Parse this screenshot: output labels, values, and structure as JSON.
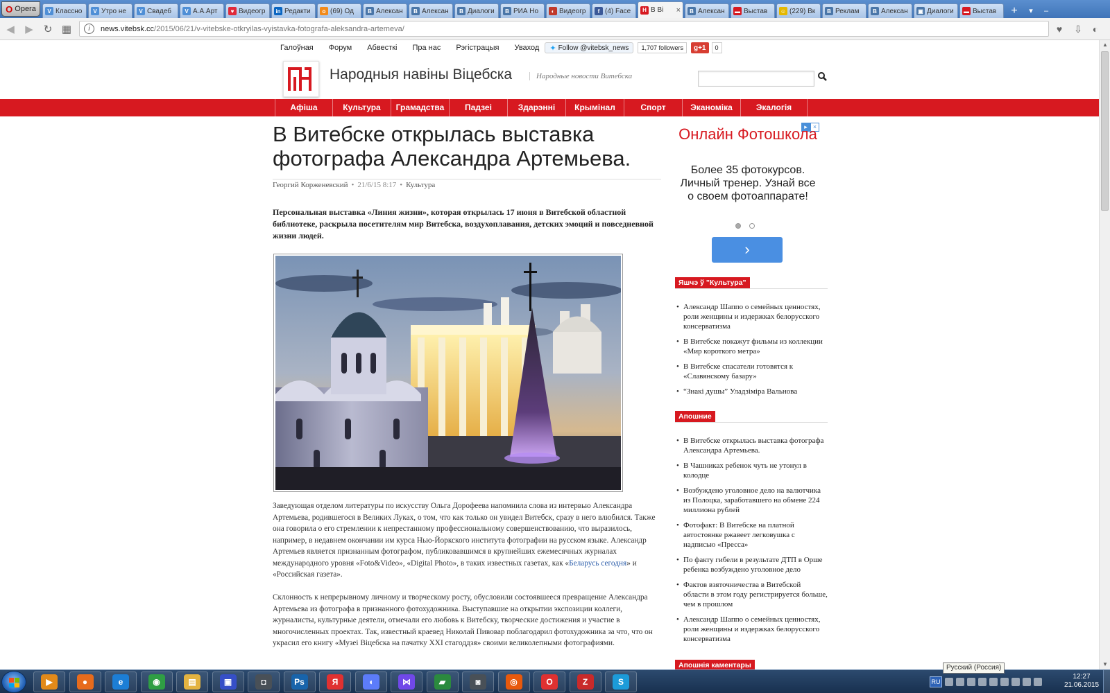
{
  "browser": {
    "menu_label": "Opera",
    "tabs": [
      {
        "label": "Классно",
        "fav": "V",
        "color": "#4f8fd6"
      },
      {
        "label": "Утро не",
        "fav": "V",
        "color": "#4f8fd6"
      },
      {
        "label": "Свадеб",
        "fav": "V",
        "color": "#4f8fd6"
      },
      {
        "label": "А.А.Арт",
        "fav": "V",
        "color": "#4f8fd6"
      },
      {
        "label": "Видеогр",
        "fav": "♥",
        "color": "#e02a3a"
      },
      {
        "label": "Редакти",
        "fav": "in",
        "color": "#0a66c2"
      },
      {
        "label": "(69) Од",
        "fav": "о",
        "color": "#f28a1a"
      },
      {
        "label": "Алексан",
        "fav": "В",
        "color": "#4a76a8"
      },
      {
        "label": "Алексан",
        "fav": "В",
        "color": "#4a76a8"
      },
      {
        "label": "Диалоги",
        "fav": "В",
        "color": "#4a76a8"
      },
      {
        "label": "РИА Но",
        "fav": "В",
        "color": "#4a76a8"
      },
      {
        "label": "Видеогр",
        "fav": "◐",
        "color": "#c0392b"
      },
      {
        "label": "(4) Face",
        "fav": "f",
        "color": "#3b5998"
      },
      {
        "label": "В Ві",
        "fav": "Н",
        "color": "#d71920",
        "active": true
      },
      {
        "label": "Алексан",
        "fav": "В",
        "color": "#4a76a8"
      },
      {
        "label": "Выстав",
        "fav": "▬",
        "color": "#d71920"
      },
      {
        "label": "(229) Вк",
        "fav": "☺",
        "color": "#e5b800"
      },
      {
        "label": "Реклам",
        "fav": "В",
        "color": "#4a76a8"
      },
      {
        "label": "Алексан",
        "fav": "В",
        "color": "#4a76a8"
      },
      {
        "label": "Диалоги",
        "fav": "▣",
        "color": "#4a76a8"
      },
      {
        "label": "Выстав",
        "fav": "▬",
        "color": "#d71920"
      }
    ],
    "url_domain": "news.vitebsk.cc",
    "url_path": "/2015/06/21/v-vitebske-otkryilas-vyistavka-fotografa-aleksandra-artemeva/"
  },
  "site": {
    "top_nav": [
      "Галоўная",
      "Форум",
      "Абвесткі",
      "Пра нас",
      "Рэгістрацыя",
      "Уваход"
    ],
    "twitter_follow": "Follow @vitebsk_news",
    "followers": "1,707 followers",
    "gplus": "g+1",
    "gplus_count": "0",
    "title": "Народныя навіны Віцебска",
    "subtitle": "Народные новости Витебска",
    "brand_color": "#d71920",
    "main_nav": [
      "Афіша",
      "Культура",
      "Грамадства",
      "Падзеі",
      "Здарэнні",
      "Крымінал",
      "Спорт",
      "Эканоміка",
      "Экалогія"
    ]
  },
  "article": {
    "title": "В Витебске открылась выставка фотографа Александра Артемьева.",
    "author": "Георгий Корженевский",
    "date": "21/6/15 8:17",
    "category": "Культура",
    "lead": "Персональная выставка «Линия жизни», которая открылась 17 июня в Витебской областной библиотеке, раскрыла посетителям мир Витебска, воздухоплавания, детских эмоций и повседневной жизни людей.",
    "p1_before_link": "Заведующая отделом литературы по искусству Ольга Дорофеева напомнила слова из интервью Александра Артемьева, родившегося в Великих Луках, о том, что как только он увидел Витебск, сразу в него влюбился. Также она говорила о его стремлении к непрестанному профессиональному совершенствованию, что выразилось, например, в недавнем окончании им курса Нью-Йоркского института фотографии на русском языке. Александр Артемьев является признанным фотографом, публиковавшимся в крупнейших ежемесячных журналах международного уровня «Foto&Video», «Digital Photo», в таких известных газетах, как «",
    "p1_link": "Беларусь сегодня",
    "p1_after_link": "» и «Российская газета».",
    "p2": "Склонность к непрерывному личному и творческому росту, обусловили состоявшееся превращение Александра Артемьева из фотографа в признанного фотохудожника. Выступавшие на открытии экспозиции коллеги, журналисты, культурные деятели, отмечали его любовь к Витебску, творческие достижения и участие в многочисленных проектах. Так, известный краевед Николай Пивовар поблагодарил фотохудожника за что, что он украсил его книгу «Музеі Віцебска на пачатку XXI стагоддзя» своими великолепными фотографиями."
  },
  "ad": {
    "title": "Онлайн Фотошкола",
    "text": "Более 35 фотокурсов. Личный тренер. Узнай все о своем фотоаппарате!",
    "button_icon": "chevron-right-icon"
  },
  "sidebar": {
    "more_culture_title": "Яшчэ ў \"Культура\"",
    "more_culture": [
      "Александр Шаппо о семейных ценностях, роли женщины и издержках белорусского консерватизма",
      "В Витебске покажут фильмы из коллекции «Мир короткого метра»",
      "В Витебске спасатели готовятся к «Славянскому базару»",
      "“Знакі душы” Уладзіміра Вальнова"
    ],
    "latest_title": "Апошние",
    "latest": [
      "В Витебске открылась выставка фотографа Александра Артемьева.",
      "В Чашниках ребенок чуть не утонул в колодце",
      "Возбуждено уголовное дело на валютчика из Полоцка, заработавшего на обмене 224 миллиона рублей",
      "Фотофакт: В Витебске на платной автостоянке ржавеет легковушка с надписью «Пресса»",
      "По факту гибели в результате ДТП в Орше ребенка возбуждено уголовное дело",
      "Фактов взяточничества в Витебской области в этом году регистрируется больше, чем в прошлом",
      "Александр Шаппо о семейных ценностях, роли женщины и издержках белорусского консерватизма"
    ],
    "comments_title": "Апошнія каментары"
  },
  "taskbar": {
    "apps": [
      {
        "name": "media-player-icon",
        "glyph": "▶",
        "color": "#e28a1a"
      },
      {
        "name": "firefox-icon",
        "glyph": "●",
        "color": "#e76b1c"
      },
      {
        "name": "internet-explorer-icon",
        "glyph": "e",
        "color": "#1c7ed6"
      },
      {
        "name": "chrome-icon",
        "glyph": "◉",
        "color": "#2f9e44"
      },
      {
        "name": "folder-icon",
        "glyph": "▤",
        "color": "#e3b341"
      },
      {
        "name": "floppy-icon",
        "glyph": "▣",
        "color": "#364fc7"
      },
      {
        "name": "camera-icon",
        "glyph": "◘",
        "color": "#495057"
      },
      {
        "name": "photoshop-icon",
        "glyph": "Ps",
        "color": "#1864ab"
      },
      {
        "name": "yandex-icon",
        "glyph": "Я",
        "color": "#e03131"
      },
      {
        "name": "speaker-icon",
        "glyph": "◖",
        "color": "#5c7cfa"
      },
      {
        "name": "visual-studio-icon",
        "glyph": "⋈",
        "color": "#7048e8"
      },
      {
        "name": "flag-app-icon",
        "glyph": "▰",
        "color": "#2b8a3e"
      },
      {
        "name": "scanner-icon",
        "glyph": "◙",
        "color": "#495057"
      },
      {
        "name": "eye-app-icon",
        "glyph": "◎",
        "color": "#e8590c"
      },
      {
        "name": "opera-icon",
        "glyph": "O",
        "color": "#e03131"
      },
      {
        "name": "zynga-icon",
        "glyph": "Z",
        "color": "#c92a2a"
      },
      {
        "name": "skype-icon",
        "glyph": "S",
        "color": "#1c9bd9"
      }
    ],
    "lang_tooltip": "Русский (Россия)",
    "lang": "RU",
    "time": "12:27",
    "date": "21.06.2015"
  }
}
